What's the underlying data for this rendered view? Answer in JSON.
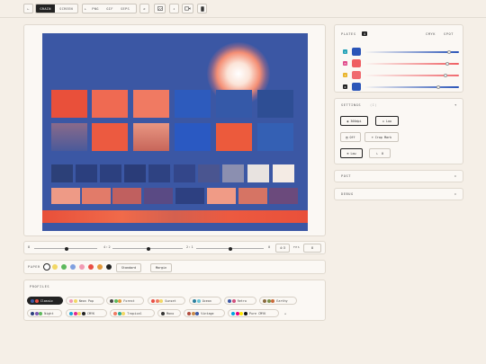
{
  "toolbar": {
    "back_icon": "arrow-left-icon",
    "mode_tabs": [
      "GRAIN",
      "SCREEN"
    ],
    "export_tabs": [
      "PNG",
      "GIF",
      "SEPS"
    ],
    "export_prefix": "+",
    "tool_icons": [
      "undo-icon",
      "image-icon",
      "sparkle-icon",
      "video-icon",
      "phone-icon"
    ]
  },
  "canvas": {
    "palette": {
      "blue": "#3b57a4",
      "red": "#e9503a",
      "salmon": "#ef7a62",
      "navy": "#2a3f7c"
    }
  },
  "controls": {
    "labels": [
      "8",
      "4:2",
      "2:1",
      "0"
    ],
    "ratio": "4:3",
    "fps_label": "FPS",
    "fps_value": "8"
  },
  "paper": {
    "label": "PAPER",
    "swatches": [
      "#ffffff",
      "#f2d764",
      "#5cb85c",
      "#7fa0e0",
      "#f29ab3",
      "#e94e44",
      "#e39a3b",
      "#222222"
    ],
    "standard": "Standard",
    "margin": "Margin"
  },
  "profiles": {
    "title": "PROFILES",
    "items": [
      {
        "label": "Classic",
        "colors": [
          "#3b57a4",
          "#e94e44"
        ],
        "active": true
      },
      {
        "label": "Neon Pop",
        "colors": [
          "#f29ab3",
          "#f2d764"
        ]
      },
      {
        "label": "Forest",
        "colors": [
          "#444",
          "#5cb85c",
          "#e39a3b"
        ]
      },
      {
        "label": "Sunset",
        "colors": [
          "#e94e44",
          "#ef7a62",
          "#f2d764"
        ]
      },
      {
        "label": "Ocean",
        "colors": [
          "#2b7f9e",
          "#6cc3d6"
        ]
      },
      {
        "label": "Retro",
        "colors": [
          "#3b57a4",
          "#d04f7c"
        ]
      },
      {
        "label": "Earthy",
        "colors": [
          "#8b6a3e",
          "#7b8f4a",
          "#c96a3a"
        ]
      },
      {
        "label": "Night",
        "colors": [
          "#2a3f7c",
          "#7b58b4",
          "#5cb85c"
        ]
      },
      {
        "label": "CMYK",
        "colors": [
          "#1aa3d9",
          "#e1258f",
          "#f2d764",
          "#222"
        ]
      },
      {
        "label": "Tropical",
        "colors": [
          "#ef7a62",
          "#2aa890",
          "#f2d764"
        ]
      },
      {
        "label": "Mono",
        "colors": [
          "#333"
        ]
      },
      {
        "label": "Vintage",
        "colors": [
          "#b04a3c",
          "#c98a4a",
          "#3b57a4"
        ]
      },
      {
        "label": "Pure CMYK",
        "colors": [
          "#00a3e0",
          "#e6007e",
          "#ffe600",
          "#111"
        ]
      }
    ],
    "add": "+"
  },
  "plates": {
    "title": "PLATES",
    "count": "4",
    "tabs": [
      "CMYK",
      "SPOT"
    ],
    "rows": [
      {
        "tag": "C",
        "tag_color": "#27a3b8",
        "color": "#2b55b8",
        "level": 0.9
      },
      {
        "tag": "M",
        "tag_color": "#e04a8a",
        "color": "#ef5e62",
        "level": 0.88
      },
      {
        "tag": "Y",
        "tag_color": "#e9b52e",
        "color": "#f06a6f",
        "level": 0.86
      },
      {
        "tag": "K",
        "tag_color": "#222",
        "color": "#2b55b8",
        "level": 0.78
      }
    ]
  },
  "settings": {
    "title": "SETTINGS",
    "hint": "(i)",
    "buttons": [
      {
        "label": "300dpi",
        "icon": "target-icon",
        "on": true
      },
      {
        "label": "Low",
        "icon": "house-icon",
        "on": true
      },
      {
        "label": "Off",
        "icon": "doc-icon",
        "on": false
      },
      {
        "label": "Crop Mark",
        "icon": "crop-icon",
        "on": false
      },
      {
        "label": "Low",
        "icon": "globe-icon",
        "on": true
      },
      {
        "label": "0",
        "icon": "angle-icon",
        "on": false
      }
    ]
  },
  "post": {
    "title": "POST"
  },
  "debug": {
    "title": "DEBUG"
  }
}
